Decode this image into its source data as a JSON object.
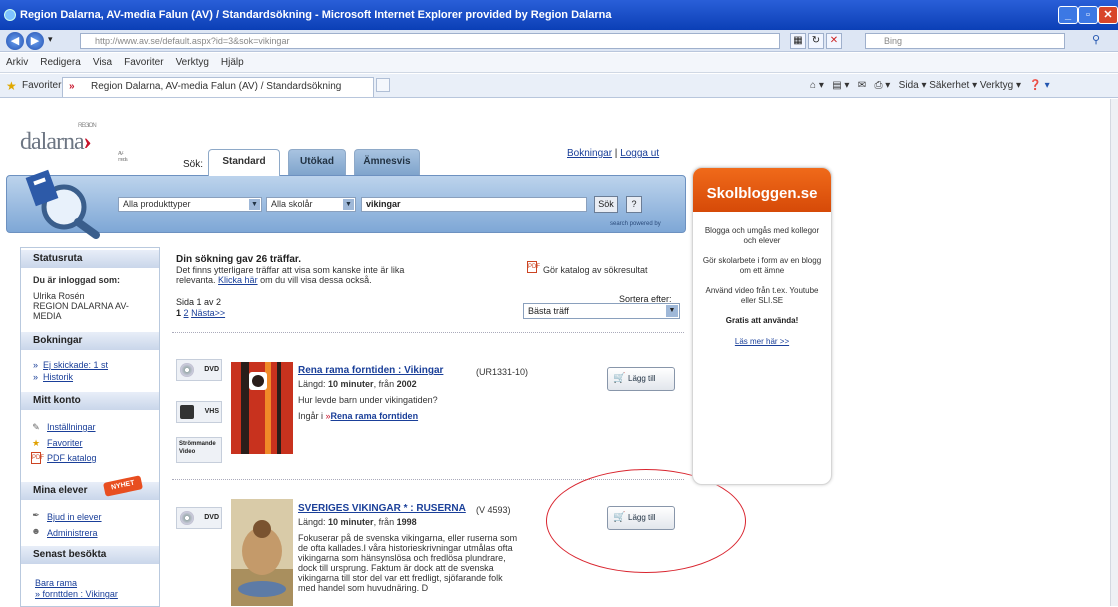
{
  "window": {
    "title": "Region Dalarna, AV-media Falun (AV) / Standardsökning - Microsoft Internet Explorer provided by Region Dalarna"
  },
  "address": {
    "url": "http://www.av.se/default.aspx?id=3&sok=vikingar",
    "search": "Bing"
  },
  "menu": [
    "Arkiv",
    "Redigera",
    "Visa",
    "Favoriter",
    "Verktyg",
    "Hjälp"
  ],
  "favorites": {
    "label": "Favoriter",
    "tab": "Region Dalarna, AV-media Falun (AV) / Standardsökning",
    "cmd": "Sida ▾   Säkerhet ▾   Verktyg ▾"
  },
  "logo": {
    "text": "dalarna",
    "region": "REGION",
    "sub": "AV-media"
  },
  "search": {
    "sok_label": "Sök:",
    "tabs": [
      "Standard",
      "Utökad",
      "Ämnesvis"
    ],
    "type": "Alla produkttyper",
    "level": "Alla skolår",
    "query": "vikingar",
    "sok_btn": "Sök",
    "help_btn": "?",
    "powered": "search powered by"
  },
  "topright": {
    "bokningar": "Bokningar",
    "separator": " | ",
    "logout": "Logga ut"
  },
  "sidebar": {
    "status_h": "Statusruta",
    "logged_in": "Du är inloggad som:",
    "user1": "Ulrika Rosén",
    "user2": "REGION DALARNA AV-",
    "user3": "MEDIA",
    "bookings_h": "Bokningar",
    "ej_skickade": "Ej skickade: 1 st",
    "historik": "Historik",
    "account_h": "Mitt konto",
    "installningar": "Inställningar",
    "favoriter": "Favoriter",
    "pdf": "PDF katalog",
    "students_h": "Mina elever",
    "badge": "NYHET",
    "invite": "Bjud in elever",
    "admin": "Administrera",
    "recent_h": "Senast besökta",
    "recent1": "Bara rama",
    "recent2": "» fornttden : Vikingar"
  },
  "results": {
    "heading": "Din sökning gav 26 träffar.",
    "note1": "Det finns ytterligare träffar att visa som kanske inte är lika",
    "note2a": "relevanta.",
    "note_link": "Klicka här",
    "note2b": "om du vill visa dessa också.",
    "catalog": "Gör katalog av sökresultat",
    "sort_label": "Sortera efter:",
    "sort_value": "Bästa träff",
    "page": "Sida 1 av 2",
    "page_link": "2",
    "next": "Nästa>>",
    "items": [
      {
        "title": "Rena rama forntiden : Vikingar",
        "code": "(UR1331-10)",
        "length_pre": "Längd:",
        "length": "10 minuter",
        "year_pre": ", från",
        "year": "2002",
        "desc": "Hur levde barn under vikingatiden?",
        "part_pre": "Ingår i",
        "part_link": "Rena rama forntiden",
        "formats": [
          "DVD",
          "VHS",
          "Strömmande Video"
        ],
        "add": "Lägg till"
      },
      {
        "title": "SVERIGES VIKINGAR * : RUSERNA",
        "code": "(V 4593)",
        "length_pre": "Längd:",
        "length": "10 minuter",
        "year_pre": ", från",
        "year": "1998",
        "desc": "Fokuserar på de svenska vikingarna, eller ruserna som de ofta kallades.I våra historieskrivningar utmålas ofta vikingarna som hänsynslösa och fredlösa plundrare, dock till ursprung. Faktum är dock att de svenska vikingarna till stor del var ett fredligt, sjöfarande folk med handel som huvudnäring. D",
        "formats": [
          "DVD"
        ],
        "add": "Lägg till"
      }
    ]
  },
  "blog": {
    "title": "Skolbloggen.se",
    "p1": "Blogga och umgås med kollegor och elever",
    "p2": "Gör skolarbete i form av en blogg om ett ämne",
    "p3": "Använd video från t.ex. Youtube eller SLI.SE",
    "free": "Gratis att använda!",
    "more": "Läs mer här >>"
  }
}
